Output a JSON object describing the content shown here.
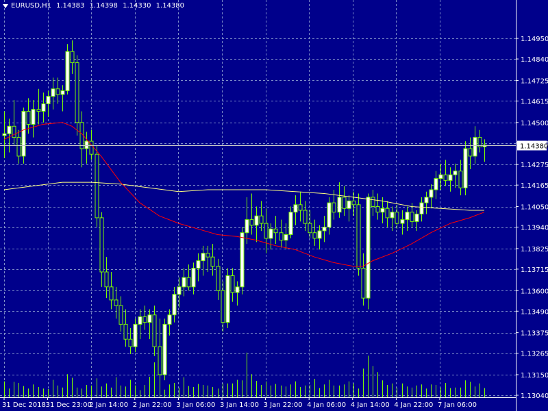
{
  "header": {
    "symbol": "EURUSD,H1",
    "open": "1.14383",
    "high": "1.14398",
    "low": "1.14330",
    "close": "1.14380"
  },
  "colors": {
    "background": "#00008b",
    "grid": "#7b8bc8",
    "candle_outline": "#7cfc00",
    "candle_bull_fill": "#ffffff",
    "candle_bear_fill": "#00008b",
    "ma_fast": "#ff0000",
    "ma_slow": "#ffff80",
    "axis_text": "#ffffff",
    "volume": "#7cfc00",
    "price_line": "#c8c8c8",
    "price_tag_bg": "#ffffff",
    "price_tag_text": "#000000"
  },
  "chart_data": {
    "type": "candlestick",
    "symbol": "EURUSD",
    "timeframe": "H1",
    "current_price": 1.1438,
    "y_ticks": [
      1.1495,
      1.1484,
      1.14725,
      1.14615,
      1.145,
      1.1439,
      1.14275,
      1.14165,
      1.1405,
      1.1394,
      1.13825,
      1.13715,
      1.136,
      1.1349,
      1.13375,
      1.13265,
      1.1315,
      1.1304
    ],
    "y_tick_labels": [
      "1.14950",
      "1.14840",
      "1.14725",
      "1.14615",
      "1.14500",
      "1.14390",
      "1.14275",
      "1.14165",
      "1.14050",
      "1.13940",
      "1.13825",
      "1.13715",
      "1.13600",
      "1.13490",
      "1.13375",
      "1.13265",
      "1.13150",
      "1.13040"
    ],
    "x_labels": [
      "31 Dec 2018",
      "31 Dec 23:00",
      "2 Jan 14:00",
      "2 Jan 22:00",
      "3 Jan 06:00",
      "3 Jan 14:00",
      "3 Jan 22:00",
      "4 Jan 06:00",
      "4 Jan 14:00",
      "4 Jan 22:00",
      "7 Jan 06:00"
    ],
    "ylim": [
      1.1304,
      1.1499
    ],
    "grid": true,
    "candles": [
      [
        1.1443,
        1.1456,
        1.1431,
        1.1444
      ],
      [
        1.1444,
        1.1452,
        1.1434,
        1.1448
      ],
      [
        1.1448,
        1.1462,
        1.1438,
        1.1442
      ],
      [
        1.1442,
        1.1446,
        1.1428,
        1.1432
      ],
      [
        1.1432,
        1.1458,
        1.1428,
        1.1456
      ],
      [
        1.1456,
        1.1463,
        1.1444,
        1.1449
      ],
      [
        1.1449,
        1.1462,
        1.1442,
        1.1457
      ],
      [
        1.1457,
        1.1468,
        1.1449,
        1.1456
      ],
      [
        1.1456,
        1.1466,
        1.145,
        1.146
      ],
      [
        1.146,
        1.1467,
        1.1453,
        1.1464
      ],
      [
        1.1464,
        1.1474,
        1.1457,
        1.1468
      ],
      [
        1.1468,
        1.1474,
        1.146,
        1.1465
      ],
      [
        1.1465,
        1.147,
        1.1456,
        1.1467
      ],
      [
        1.1467,
        1.1492,
        1.1465,
        1.1488
      ],
      [
        1.1488,
        1.1494,
        1.1476,
        1.1482
      ],
      [
        1.1482,
        1.1486,
        1.1443,
        1.145
      ],
      [
        1.145,
        1.1456,
        1.1426,
        1.1436
      ],
      [
        1.1436,
        1.1445,
        1.1428,
        1.144
      ],
      [
        1.144,
        1.1446,
        1.143,
        1.1433
      ],
      [
        1.1433,
        1.1438,
        1.1394,
        1.1399
      ],
      [
        1.1399,
        1.1402,
        1.1362,
        1.137
      ],
      [
        1.137,
        1.1378,
        1.1356,
        1.1362
      ],
      [
        1.1362,
        1.137,
        1.135,
        1.1355
      ],
      [
        1.1355,
        1.1362,
        1.1345,
        1.1352
      ],
      [
        1.1352,
        1.1357,
        1.1338,
        1.1342
      ],
      [
        1.1342,
        1.135,
        1.133,
        1.1334
      ],
      [
        1.1334,
        1.134,
        1.1326,
        1.133
      ],
      [
        1.133,
        1.1345,
        1.1327,
        1.1342
      ],
      [
        1.1342,
        1.135,
        1.1334,
        1.1346
      ],
      [
        1.1346,
        1.1352,
        1.1339,
        1.1343
      ],
      [
        1.1343,
        1.135,
        1.1334,
        1.1347
      ],
      [
        1.1347,
        1.1352,
        1.1325,
        1.133
      ],
      [
        1.133,
        1.1345,
        1.1312,
        1.1315
      ],
      [
        1.1315,
        1.1345,
        1.1312,
        1.1342
      ],
      [
        1.1342,
        1.135,
        1.1336,
        1.1347
      ],
      [
        1.1347,
        1.1362,
        1.1343,
        1.1358
      ],
      [
        1.1358,
        1.1367,
        1.1351,
        1.1362
      ],
      [
        1.1362,
        1.1372,
        1.1357,
        1.1367
      ],
      [
        1.1367,
        1.1374,
        1.136,
        1.1362
      ],
      [
        1.1362,
        1.1375,
        1.1358,
        1.1372
      ],
      [
        1.1372,
        1.138,
        1.1365,
        1.1376
      ],
      [
        1.1376,
        1.1384,
        1.1368,
        1.138
      ],
      [
        1.138,
        1.1384,
        1.137,
        1.1378
      ],
      [
        1.1378,
        1.1385,
        1.1368,
        1.1373
      ],
      [
        1.1373,
        1.1377,
        1.1355,
        1.136
      ],
      [
        1.136,
        1.1365,
        1.1338,
        1.1343
      ],
      [
        1.1343,
        1.1372,
        1.134,
        1.1368
      ],
      [
        1.1368,
        1.1372,
        1.1354,
        1.1359
      ],
      [
        1.1359,
        1.1365,
        1.1352,
        1.1362
      ],
      [
        1.1362,
        1.1394,
        1.1358,
        1.1391
      ],
      [
        1.1391,
        1.141,
        1.1385,
        1.1398
      ],
      [
        1.1398,
        1.1412,
        1.139,
        1.1395
      ],
      [
        1.1395,
        1.1405,
        1.1386,
        1.14
      ],
      [
        1.14,
        1.1408,
        1.1392,
        1.1396
      ],
      [
        1.1396,
        1.1404,
        1.138,
        1.1388
      ],
      [
        1.1388,
        1.1396,
        1.1382,
        1.1393
      ],
      [
        1.1393,
        1.14,
        1.1385,
        1.1391
      ],
      [
        1.1391,
        1.1398,
        1.1383,
        1.1387
      ],
      [
        1.1387,
        1.1396,
        1.1382,
        1.139
      ],
      [
        1.139,
        1.1405,
        1.1388,
        1.1402
      ],
      [
        1.1402,
        1.1411,
        1.1395,
        1.1406
      ],
      [
        1.1406,
        1.1413,
        1.1397,
        1.1403
      ],
      [
        1.1403,
        1.1408,
        1.1392,
        1.1396
      ],
      [
        1.1396,
        1.1403,
        1.1388,
        1.1391
      ],
      [
        1.1391,
        1.1398,
        1.1384,
        1.1388
      ],
      [
        1.1388,
        1.1395,
        1.1382,
        1.1392
      ],
      [
        1.1392,
        1.14,
        1.1386,
        1.1394
      ],
      [
        1.1394,
        1.141,
        1.139,
        1.1407
      ],
      [
        1.1407,
        1.1414,
        1.1398,
        1.1402
      ],
      [
        1.1402,
        1.1418,
        1.1399,
        1.141
      ],
      [
        1.141,
        1.1416,
        1.14,
        1.1404
      ],
      [
        1.1404,
        1.1411,
        1.1397,
        1.1408
      ],
      [
        1.1408,
        1.1413,
        1.14,
        1.1406
      ],
      [
        1.1406,
        1.1412,
        1.1368,
        1.1372
      ],
      [
        1.1372,
        1.138,
        1.1352,
        1.1356
      ],
      [
        1.1356,
        1.1412,
        1.135,
        1.141
      ],
      [
        1.141,
        1.1414,
        1.14,
        1.1405
      ],
      [
        1.1405,
        1.1412,
        1.1398,
        1.1402
      ],
      [
        1.1402,
        1.141,
        1.1396,
        1.1404
      ],
      [
        1.1404,
        1.1408,
        1.1394,
        1.1399
      ],
      [
        1.1399,
        1.1405,
        1.1392,
        1.1402
      ],
      [
        1.1402,
        1.1406,
        1.1393,
        1.1396
      ],
      [
        1.1396,
        1.1403,
        1.139,
        1.1398
      ],
      [
        1.1398,
        1.1405,
        1.1392,
        1.1402
      ],
      [
        1.1402,
        1.1407,
        1.1394,
        1.1397
      ],
      [
        1.1397,
        1.1403,
        1.1392,
        1.1401
      ],
      [
        1.1401,
        1.141,
        1.1397,
        1.1407
      ],
      [
        1.1407,
        1.1413,
        1.1401,
        1.141
      ],
      [
        1.141,
        1.1417,
        1.1404,
        1.1414
      ],
      [
        1.1414,
        1.1424,
        1.1409,
        1.142
      ],
      [
        1.142,
        1.1428,
        1.1414,
        1.1422
      ],
      [
        1.1422,
        1.143,
        1.1416,
        1.1419
      ],
      [
        1.1419,
        1.1426,
        1.1413,
        1.1422
      ],
      [
        1.1422,
        1.1428,
        1.1415,
        1.1424
      ],
      [
        1.1424,
        1.143,
        1.1411,
        1.1415
      ],
      [
        1.1415,
        1.144,
        1.1411,
        1.1436
      ],
      [
        1.1436,
        1.1442,
        1.1425,
        1.1432
      ],
      [
        1.1432,
        1.1448,
        1.1428,
        1.1442
      ],
      [
        1.1442,
        1.1446,
        1.1434,
        1.1437
      ],
      [
        1.1437,
        1.1441,
        1.1429,
        1.1438
      ]
    ],
    "ma_fast": [
      [
        0,
        1.1441
      ],
      [
        4,
        1.1446
      ],
      [
        8,
        1.1449
      ],
      [
        12,
        1.145
      ],
      [
        14,
        1.1448
      ],
      [
        16,
        1.1444
      ],
      [
        20,
        1.1432
      ],
      [
        24,
        1.1418
      ],
      [
        28,
        1.1407
      ],
      [
        32,
        1.14
      ],
      [
        36,
        1.1396
      ],
      [
        40,
        1.1393
      ],
      [
        44,
        1.139
      ],
      [
        48,
        1.1389
      ],
      [
        52,
        1.1387
      ],
      [
        56,
        1.1384
      ],
      [
        60,
        1.1382
      ],
      [
        64,
        1.1378
      ],
      [
        68,
        1.1375
      ],
      [
        72,
        1.1373
      ],
      [
        74,
        1.1373
      ],
      [
        76,
        1.1376
      ],
      [
        80,
        1.138
      ],
      [
        84,
        1.1385
      ],
      [
        88,
        1.1391
      ],
      [
        92,
        1.1396
      ],
      [
        96,
        1.1399
      ],
      [
        99,
        1.1402
      ]
    ],
    "ma_slow": [
      [
        0,
        1.1414
      ],
      [
        6,
        1.1416
      ],
      [
        12,
        1.1418
      ],
      [
        18,
        1.1418
      ],
      [
        24,
        1.1417
      ],
      [
        30,
        1.1415
      ],
      [
        36,
        1.1413
      ],
      [
        42,
        1.1414
      ],
      [
        48,
        1.1414
      ],
      [
        54,
        1.1414
      ],
      [
        60,
        1.1413
      ],
      [
        66,
        1.1412
      ],
      [
        72,
        1.141
      ],
      [
        78,
        1.1408
      ],
      [
        84,
        1.1405
      ],
      [
        90,
        1.1404
      ],
      [
        96,
        1.1403
      ],
      [
        99,
        1.1403
      ]
    ],
    "volume": [
      31,
      17,
      30,
      28,
      22,
      17,
      25,
      20,
      17,
      16,
      34,
      23,
      19,
      45,
      38,
      19,
      17,
      24,
      23,
      37,
      21,
      27,
      19,
      39,
      23,
      21,
      34,
      23,
      14,
      24,
      40,
      68,
      49,
      15,
      25,
      28,
      19,
      39,
      22,
      20,
      26,
      24,
      23,
      20,
      17,
      27,
      27,
      27,
      34,
      33,
      87,
      45,
      32,
      24,
      31,
      23,
      26,
      23,
      21,
      25,
      31,
      20,
      23,
      24,
      36,
      18,
      25,
      34,
      23,
      23,
      25,
      31,
      27,
      17,
      56,
      81,
      61,
      49,
      33,
      24,
      27,
      19,
      27,
      21,
      19,
      23,
      25,
      17,
      25,
      24,
      19,
      28,
      18,
      19,
      19,
      33,
      30,
      21,
      27,
      18
    ]
  }
}
